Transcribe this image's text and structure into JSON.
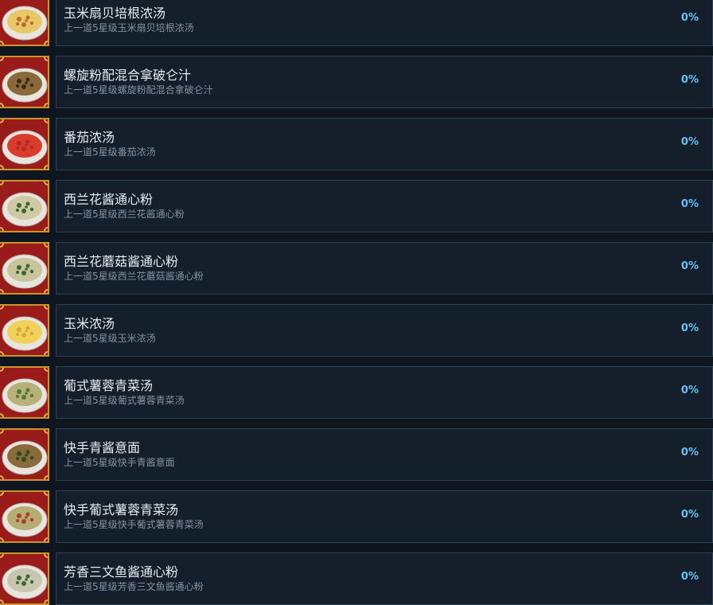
{
  "achievements": [
    {
      "title": "玉米扇贝培根浓汤",
      "description": "上一道5星级玉米扇贝培根浓汤",
      "percent": "0%",
      "icon": "corn-scallop-bacon-chowder-icon",
      "soup_color": "#e9c768",
      "garnish_color": "#b5702e"
    },
    {
      "title": "螺旋粉配混合拿破仑汁",
      "description": "上一道5星级螺旋粉配混合拿破仑汁",
      "percent": "0%",
      "icon": "fusilli-napoli-sauce-icon",
      "soup_color": "#8a6a3a",
      "garnish_color": "#3d2a1a"
    },
    {
      "title": "番茄浓汤",
      "description": "上一道5星级番茄浓汤",
      "percent": "0%",
      "icon": "tomato-soup-icon",
      "soup_color": "#d93b2c",
      "garnish_color": "#b52a22"
    },
    {
      "title": "西兰花酱通心粉",
      "description": "上一道5星级西兰花酱通心粉",
      "percent": "0%",
      "icon": "broccoli-macaroni-icon",
      "soup_color": "#cfcaa5",
      "garnish_color": "#3c6a2a"
    },
    {
      "title": "西兰花蘑菇酱通心粉",
      "description": "上一道5星级西兰花蘑菇酱通心粉",
      "percent": "0%",
      "icon": "broccoli-mushroom-macaroni-icon",
      "soup_color": "#c9c49e",
      "garnish_color": "#3c6a2a"
    },
    {
      "title": "玉米浓汤",
      "description": "上一道5星级玉米浓汤",
      "percent": "0%",
      "icon": "corn-soup-icon",
      "soup_color": "#f0d25a",
      "garnish_color": "#d9a83a"
    },
    {
      "title": "葡式薯蓉青菜汤",
      "description": "上一道5星级葡式薯蓉青菜汤",
      "percent": "0%",
      "icon": "caldo-verde-icon",
      "soup_color": "#b8b07a",
      "garnish_color": "#4f7a2c"
    },
    {
      "title": "快手青酱意面",
      "description": "上一道5星级快手青酱意面",
      "percent": "0%",
      "icon": "quick-pesto-pasta-icon",
      "soup_color": "#8a6a3a",
      "garnish_color": "#2e4a1e"
    },
    {
      "title": "快手葡式薯蓉青菜汤",
      "description": "上一道5星级快手葡式薯蓉青菜汤",
      "percent": "0%",
      "icon": "quick-caldo-verde-icon",
      "soup_color": "#b5ad72",
      "garnish_color": "#a8402e"
    },
    {
      "title": "芳香三文鱼酱通心粉",
      "description": "上一道5星级芳香三文鱼酱通心粉",
      "percent": "0%",
      "icon": "aromatic-salmon-macaroni-icon",
      "soup_color": "#c8c6b0",
      "garnish_color": "#3d6a2a"
    }
  ],
  "colors": {
    "background": "#0f161f",
    "card": "#141f2b",
    "card_border": "#2a4458",
    "percent": "#66c0f4",
    "icon_frame": "#9a1c1a"
  }
}
